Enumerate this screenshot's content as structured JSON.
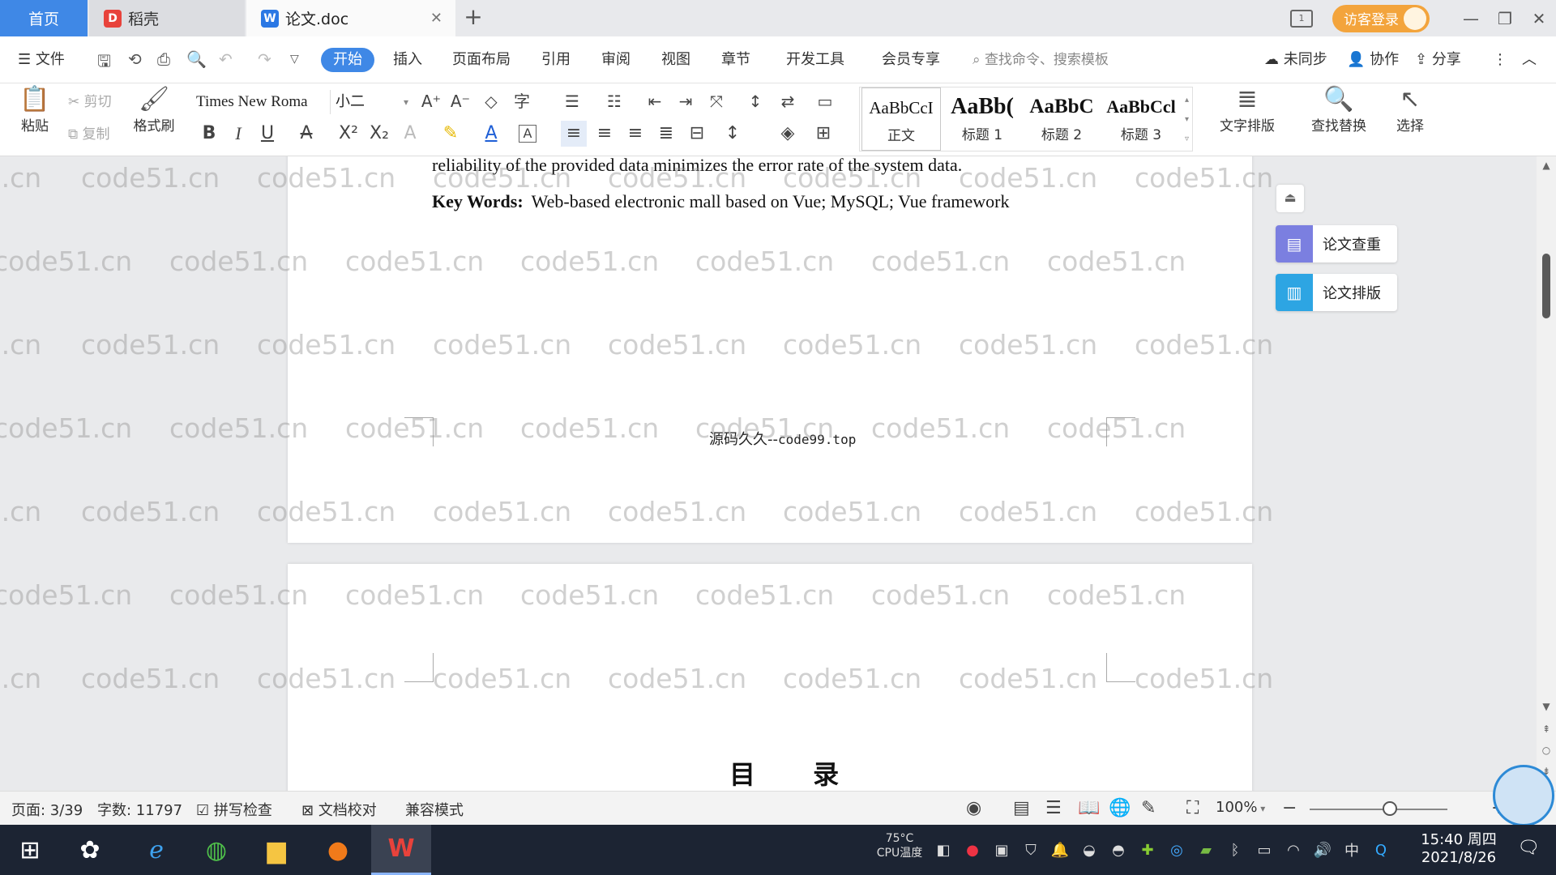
{
  "tabs": {
    "home": "首页",
    "docer": "稻壳",
    "doc": "论文.doc"
  },
  "title_right": {
    "login": "访客登录"
  },
  "menu": {
    "file": "文件",
    "tabs": [
      "开始",
      "插入",
      "页面布局",
      "引用",
      "审阅",
      "视图",
      "章节",
      "开发工具",
      "会员专享"
    ],
    "search_placeholder": "查找命令、搜索模板",
    "sync": "未同步",
    "collab": "协作",
    "share": "分享"
  },
  "ribbon": {
    "paste": "粘贴",
    "cut": "剪切",
    "copy": "复制",
    "format_painter": "格式刷",
    "font_name": "Times New Roma",
    "font_size": "小二",
    "styles": [
      {
        "preview": "AaBbCcI",
        "label": "正文"
      },
      {
        "preview": "AaBb(",
        "label": "标题 1"
      },
      {
        "preview": "AaBbC",
        "label": "标题 2"
      },
      {
        "preview": "AaBbCcl",
        "label": "标题 3"
      }
    ],
    "text_layout": "文字排版",
    "find_replace": "查找替换",
    "select": "选择"
  },
  "document": {
    "abstract_tail": "reliability of the provided data minimizes the error rate of the system data.",
    "keywords_label": "Key Words:",
    "keywords_text": "Web-based electronic mall based on Vue; MySQL; Vue framework",
    "footer_cn": "源码久久--",
    "footer_url": "code99.top",
    "toc_title": "目 录"
  },
  "side_panel": {
    "check": "论文查重",
    "format": "论文排版"
  },
  "watermark": "code51.cn",
  "status": {
    "page": "页面: 3/39",
    "words": "字数: 11797",
    "spell": "拼写检查",
    "proof": "文档校对",
    "compat": "兼容模式",
    "zoom": "100%",
    "zoom_fraction": 0.5
  },
  "taskbar": {
    "cpu_temp": "75°C",
    "cpu_label": "CPU温度",
    "time": "15:40 周四",
    "date": "2021/8/26",
    "ime": "中"
  },
  "colors": {
    "accent": "#3f88e6",
    "login": "#f3a43c",
    "side_check": "#7b7fe0",
    "side_format": "#2da5e3"
  }
}
